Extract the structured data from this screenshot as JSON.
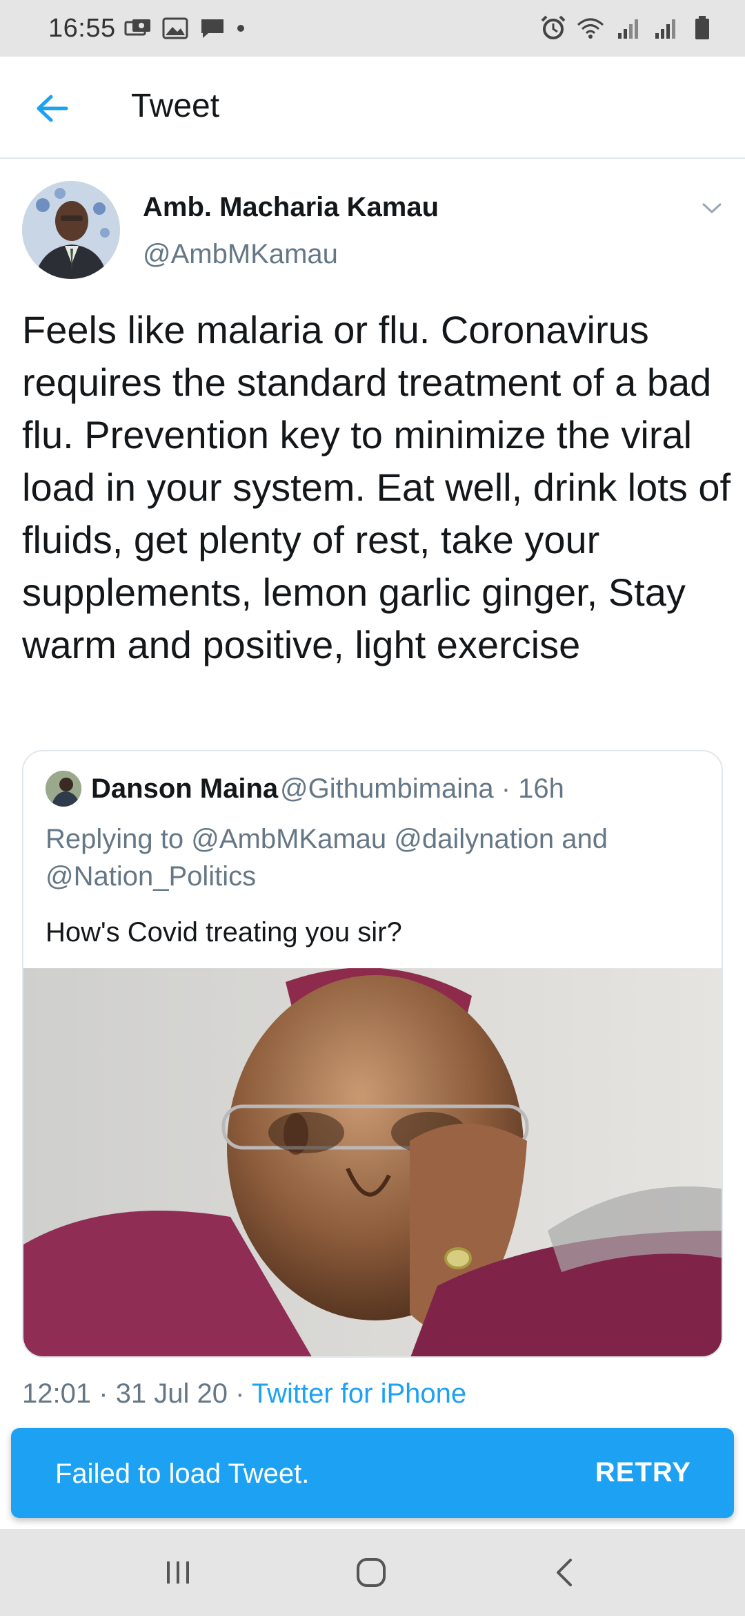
{
  "status_bar": {
    "time": "16:55",
    "left_icons": [
      "sync-icon",
      "image-icon",
      "chat-icon",
      "dot-icon"
    ],
    "right_icons": [
      "alarm-icon",
      "wifi-icon",
      "signal-icon",
      "signal-icon",
      "battery-icon"
    ]
  },
  "app_bar": {
    "title": "Tweet",
    "back_icon": "arrow-left-icon"
  },
  "tweet": {
    "author_name": "Amb. Macharia Kamau",
    "author_handle": "@AmbMKamau",
    "text": "Feels like malaria or flu. Coronavirus requires the standard treatment of a bad flu. Prevention key to minimize the viral load in your system. Eat well, drink lots of fluids, get plenty of rest, take your supplements, lemon garlic ginger, Stay warm and positive, light exercise",
    "time": "12:01",
    "date": "31 Jul 20",
    "separator": "·",
    "source": "Twitter for iPhone"
  },
  "quoted_tweet": {
    "author_name": "Danson Maina",
    "author_handle": "@Githumbimaina · 16h",
    "reply_line": "Replying to @AmbMKamau @dailynation and @Nation_Politics",
    "text": "How's Covid treating you sir?"
  },
  "snackbar": {
    "message": "Failed to load Tweet.",
    "action": "RETRY"
  },
  "nav_bar": {
    "buttons": [
      "recent-apps-icon",
      "home-icon",
      "back-icon"
    ]
  },
  "colors": {
    "accent": "#1da1f2",
    "secondary_text": "#657786",
    "primary_text": "#14171a"
  }
}
